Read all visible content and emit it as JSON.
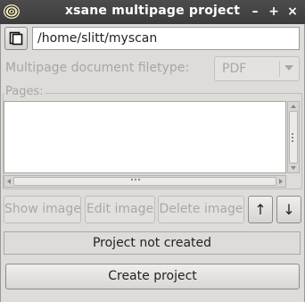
{
  "window": {
    "title": "xsane multipage project",
    "minimize": "–",
    "maximize": "+",
    "close": "×"
  },
  "project": {
    "path": "/home/slitt/myscan"
  },
  "filetype": {
    "label": "Multipage document filetype:",
    "selected": "PDF"
  },
  "pages": {
    "label": "Pages:",
    "items": []
  },
  "actions": {
    "show_image": "Show image",
    "edit_image": "Edit image",
    "delete_image": "Delete image",
    "move_up": "↑",
    "move_down": "↓"
  },
  "status": {
    "text": "Project not created"
  },
  "create_button": "Create project"
}
